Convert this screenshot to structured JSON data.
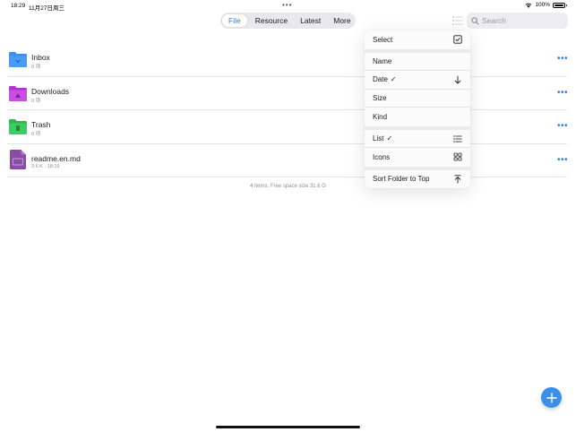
{
  "status_bar": {
    "time": "18:29",
    "date": "11月27日周三",
    "dots": "•••",
    "battery": "100%"
  },
  "tabs": [
    {
      "label": "File",
      "active": true
    },
    {
      "label": "Resource",
      "active": false
    },
    {
      "label": "Latest",
      "active": false
    },
    {
      "label": "More",
      "active": false
    }
  ],
  "search": {
    "placeholder": "Search"
  },
  "files": [
    {
      "name": "Inbox",
      "meta": "0 项",
      "icon": "folder-inbox-icon",
      "color": "#3d8ef0"
    },
    {
      "name": "Downloads",
      "meta": "0 项",
      "icon": "folder-downloads-icon",
      "color": "#c240d6"
    },
    {
      "name": "Trash",
      "meta": "0 项",
      "icon": "folder-trash-icon",
      "color": "#34c35a"
    },
    {
      "name": "readme.en.md",
      "meta": "3.6 K · 18:19",
      "icon": "markdown-file-icon",
      "color": "#8a4ca8"
    }
  ],
  "footer": "4 items, Free space size 31.6 G",
  "menu": {
    "select": "Select",
    "name": "Name",
    "date": "Date",
    "date_check": "✓",
    "size": "Size",
    "kind": "Kind",
    "list": "List",
    "list_check": "✓",
    "icons": "Icons",
    "sort_folder": "Sort Folder to Top"
  },
  "colors": {
    "accent": "#2a7ee0",
    "fab": "#3b8fe8"
  }
}
